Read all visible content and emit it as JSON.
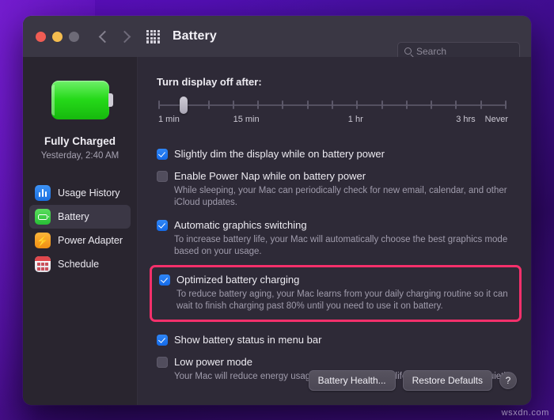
{
  "window": {
    "title": "Battery",
    "traffic_lights": [
      "close",
      "minimize",
      "zoom"
    ],
    "nav": {
      "back": "back-arrow",
      "forward": "forward-arrow",
      "show_all": "grid-icon"
    },
    "search": {
      "placeholder": "Search",
      "value": "",
      "icon": "search-icon"
    }
  },
  "sidebar": {
    "status": {
      "title": "Fully Charged",
      "subtitle": "Yesterday, 2:40 AM",
      "icon": "battery-full-icon"
    },
    "items": [
      {
        "label": "Usage History",
        "icon": "bar-chart-icon",
        "selected": false
      },
      {
        "label": "Battery",
        "icon": "battery-icon",
        "selected": true
      },
      {
        "label": "Power Adapter",
        "icon": "lightning-bolt-icon",
        "selected": false
      },
      {
        "label": "Schedule",
        "icon": "calendar-icon",
        "selected": false
      }
    ]
  },
  "main": {
    "slider": {
      "title": "Turn display off after:",
      "tick_labels": [
        "1 min",
        "15 min",
        "1 hr",
        "3 hrs",
        "Never"
      ],
      "tick_count": 15,
      "value_index": 1
    },
    "options": [
      {
        "label": "Slightly dim the display while on battery power",
        "checked": true,
        "description": ""
      },
      {
        "label": "Enable Power Nap while on battery power",
        "checked": false,
        "description": "While sleeping, your Mac can periodically check for new email, calendar, and other iCloud updates."
      },
      {
        "label": "Automatic graphics switching",
        "checked": true,
        "description": "To increase battery life, your Mac will automatically choose the best graphics mode based on your usage."
      },
      {
        "label": "Optimized battery charging",
        "checked": true,
        "description": "To reduce battery aging, your Mac learns from your daily charging routine so it can wait to finish charging past 80% until you need to use it on battery.",
        "highlighted": true
      },
      {
        "label": "Show battery status in menu bar",
        "checked": true,
        "description": ""
      },
      {
        "label": "Low power mode",
        "checked": false,
        "description": "Your Mac will reduce energy usage to increase battery life and operate more quietly."
      }
    ],
    "footer": {
      "battery_health": "Battery Health...",
      "restore_defaults": "Restore Defaults",
      "help": "?"
    }
  },
  "highlight_color": "#f5306b",
  "watermark": "wsxdn.com"
}
